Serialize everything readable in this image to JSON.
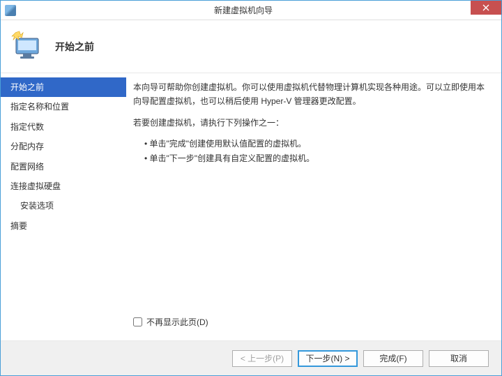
{
  "window": {
    "title": "新建虚拟机向导"
  },
  "header": {
    "title": "开始之前"
  },
  "sidebar": {
    "items": [
      {
        "label": "开始之前",
        "active": true
      },
      {
        "label": "指定名称和位置"
      },
      {
        "label": "指定代数"
      },
      {
        "label": "分配内存"
      },
      {
        "label": "配置网络"
      },
      {
        "label": "连接虚拟硬盘"
      },
      {
        "label": "安装选项",
        "indent": true
      },
      {
        "label": "摘要"
      }
    ]
  },
  "content": {
    "intro": "本向导可帮助你创建虚拟机。你可以使用虚拟机代替物理计算机实现各种用途。可以立即使用本向导配置虚拟机，也可以稍后使用 Hyper-V 管理器更改配置。",
    "prompt": "若要创建虚拟机，请执行下列操作之一：",
    "bullet1": "单击\"完成\"创建使用默认值配置的虚拟机。",
    "bullet2": "单击\"下一步\"创建具有自定义配置的虚拟机。",
    "checkbox_label": "不再显示此页(D)"
  },
  "footer": {
    "prev": "< 上一步(P)",
    "next": "下一步(N) >",
    "finish": "完成(F)",
    "cancel": "取消"
  }
}
